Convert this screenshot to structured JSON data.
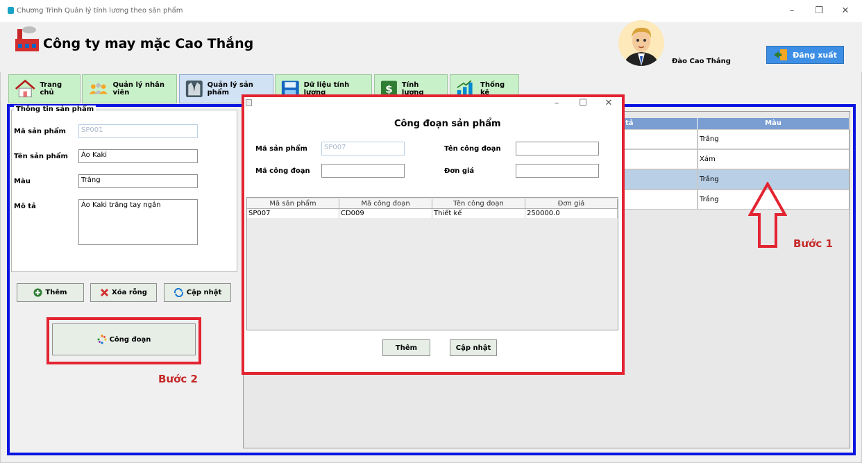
{
  "window": {
    "title": "Chương Trình Quản lý tính lương theo sản phẩm",
    "minimize_icon": "minimize-icon",
    "restore_icon": "restore-icon",
    "close_icon": "close-icon"
  },
  "header": {
    "company": "Công ty may mặc Cao Thắng",
    "username": "Đào Cao Thắng",
    "logout_label": "Đăng xuất"
  },
  "tabs": [
    {
      "label": "Trang chủ",
      "icon": "house-icon"
    },
    {
      "label": "Quản lý nhân viên",
      "icon": "people-icon"
    },
    {
      "label": "Quản lý sản phẩm",
      "icon": "suit-icon"
    },
    {
      "label": "Dữ liệu tính lương",
      "icon": "floppy-icon"
    },
    {
      "label": "Tính lương",
      "icon": "dollar-icon"
    },
    {
      "label": "Thống kê",
      "icon": "bar-chart-icon"
    }
  ],
  "product_form": {
    "title": "Thông tin sản phẩm",
    "code_label": "Mã sản phẩm",
    "code_value": "SP001",
    "name_label": "Tên sản phẩm",
    "name_value": "Áo Kaki",
    "color_label": "Màu",
    "color_value": "Trắng",
    "desc_label": "Mô tả",
    "desc_value": "Áo Kaki trắng tay ngắn",
    "add_label": "Thêm",
    "clear_label": "Xóa rỗng",
    "update_label": "Cập nhật",
    "stages_label": "Công đoạn"
  },
  "product_table": {
    "headers": [
      "tả",
      "Màu"
    ],
    "rows": [
      {
        "color": "Trắng"
      },
      {
        "color": "Xám"
      },
      {
        "color": "Trắng"
      },
      {
        "color": "Trắng"
      }
    ]
  },
  "annotations": {
    "step1": "Bước 1",
    "step2": "Bước 2"
  },
  "dialog": {
    "title": "Công đoạn sản phẩm",
    "code_label": "Mã sản phẩm",
    "code_value": "SP007",
    "stage_name_label": "Tên công đoạn",
    "stage_code_label": "Mã công đoạn",
    "price_label": "Đơn giá",
    "add_label": "Thêm",
    "update_label": "Cập nhật",
    "table": {
      "headers": [
        "Mã sản phẩm",
        "Mã công đoạn",
        "Tên công đoạn",
        "Đơn giá"
      ],
      "rows": [
        [
          "SP007",
          "CD009",
          "Thiết kế",
          "250000.0"
        ]
      ]
    }
  },
  "colors": {
    "accent_blue": "#0a14e0",
    "highlight_red": "#e32331",
    "tab_green": "#c9f1c9"
  }
}
